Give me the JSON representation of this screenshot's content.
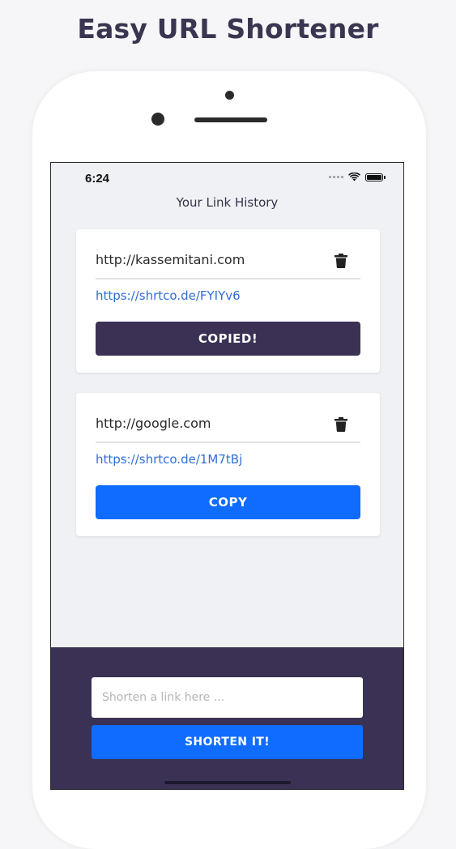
{
  "headline": "Easy URL Shortener",
  "status_bar": {
    "time": "6:24"
  },
  "screen": {
    "title": "Your Link History",
    "links": [
      {
        "original": "http://kassemitani.com",
        "short": "https://shrtco.de/FYIYv6",
        "button": "COPIED!",
        "state": "copied"
      },
      {
        "original": "http://google.com",
        "short": "https://shrtco.de/1M7tBj",
        "button": "COPY",
        "state": "default"
      }
    ]
  },
  "form": {
    "placeholder": "Shorten a link here ...",
    "value": "",
    "submit_label": "SHORTEN IT!"
  },
  "icons": {
    "delete": "trash-icon",
    "wifi": "wifi-icon",
    "battery": "battery-icon",
    "signal": "signal-icon"
  },
  "colors": {
    "primary": "#0f6cff",
    "dark": "#3b3154",
    "link": "#2f6fd6",
    "background": "#eff1f5"
  }
}
